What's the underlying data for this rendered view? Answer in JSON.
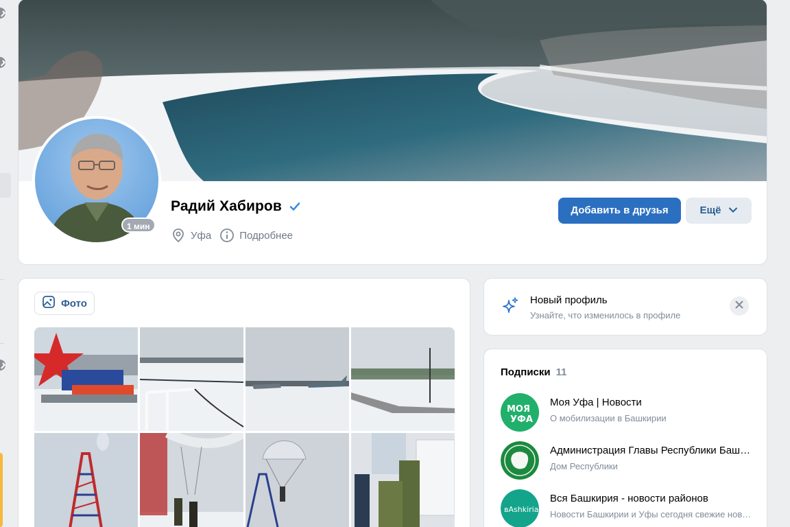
{
  "profile": {
    "name": "Радий Хабиров",
    "online_status": "1 мин",
    "city": "Уфа",
    "details_link": "Подробнее",
    "add_friend_label": "Добавить в друзья",
    "more_label": "Ещё"
  },
  "photos": {
    "tab_label": "Фото",
    "grid": [
      {
        "icon": "stela-patriot"
      },
      {
        "icon": "winter-park"
      },
      {
        "icon": "aircraft-display"
      },
      {
        "icon": "park-walkway"
      },
      {
        "icon": "parachute-tower"
      },
      {
        "icon": "parachute-jump"
      },
      {
        "icon": "parachute-training"
      },
      {
        "icon": "equipment-fitting"
      }
    ]
  },
  "new_profile": {
    "title": "Новый профиль",
    "subtitle": "Узнайте, что изменилось в профиле"
  },
  "subscriptions": {
    "title": "Подписки",
    "count": "11",
    "items": [
      {
        "title": "Моя Уфа | Новости",
        "desc": "О мобилизации в Башкирии",
        "avatar_text": "МОЯ УФА",
        "avatar_color": "#1fa86a"
      },
      {
        "title": "Администрация Главы Республики Башкортостан",
        "desc": "Дом Республики",
        "avatar_text": "",
        "avatar_color": "#1c8a3e"
      },
      {
        "title": "Вся Башкирия - новости районов",
        "desc": "Новости Башкирии и Уфы сегодня свежие новости",
        "avatar_text": "вAshkiria",
        "avatar_color": "#14a48c"
      }
    ]
  },
  "colors": {
    "accent": "#2b6fc1",
    "secondary_btn": "#e5ebf1",
    "link": "#2c5e94",
    "muted": "#818c99"
  }
}
